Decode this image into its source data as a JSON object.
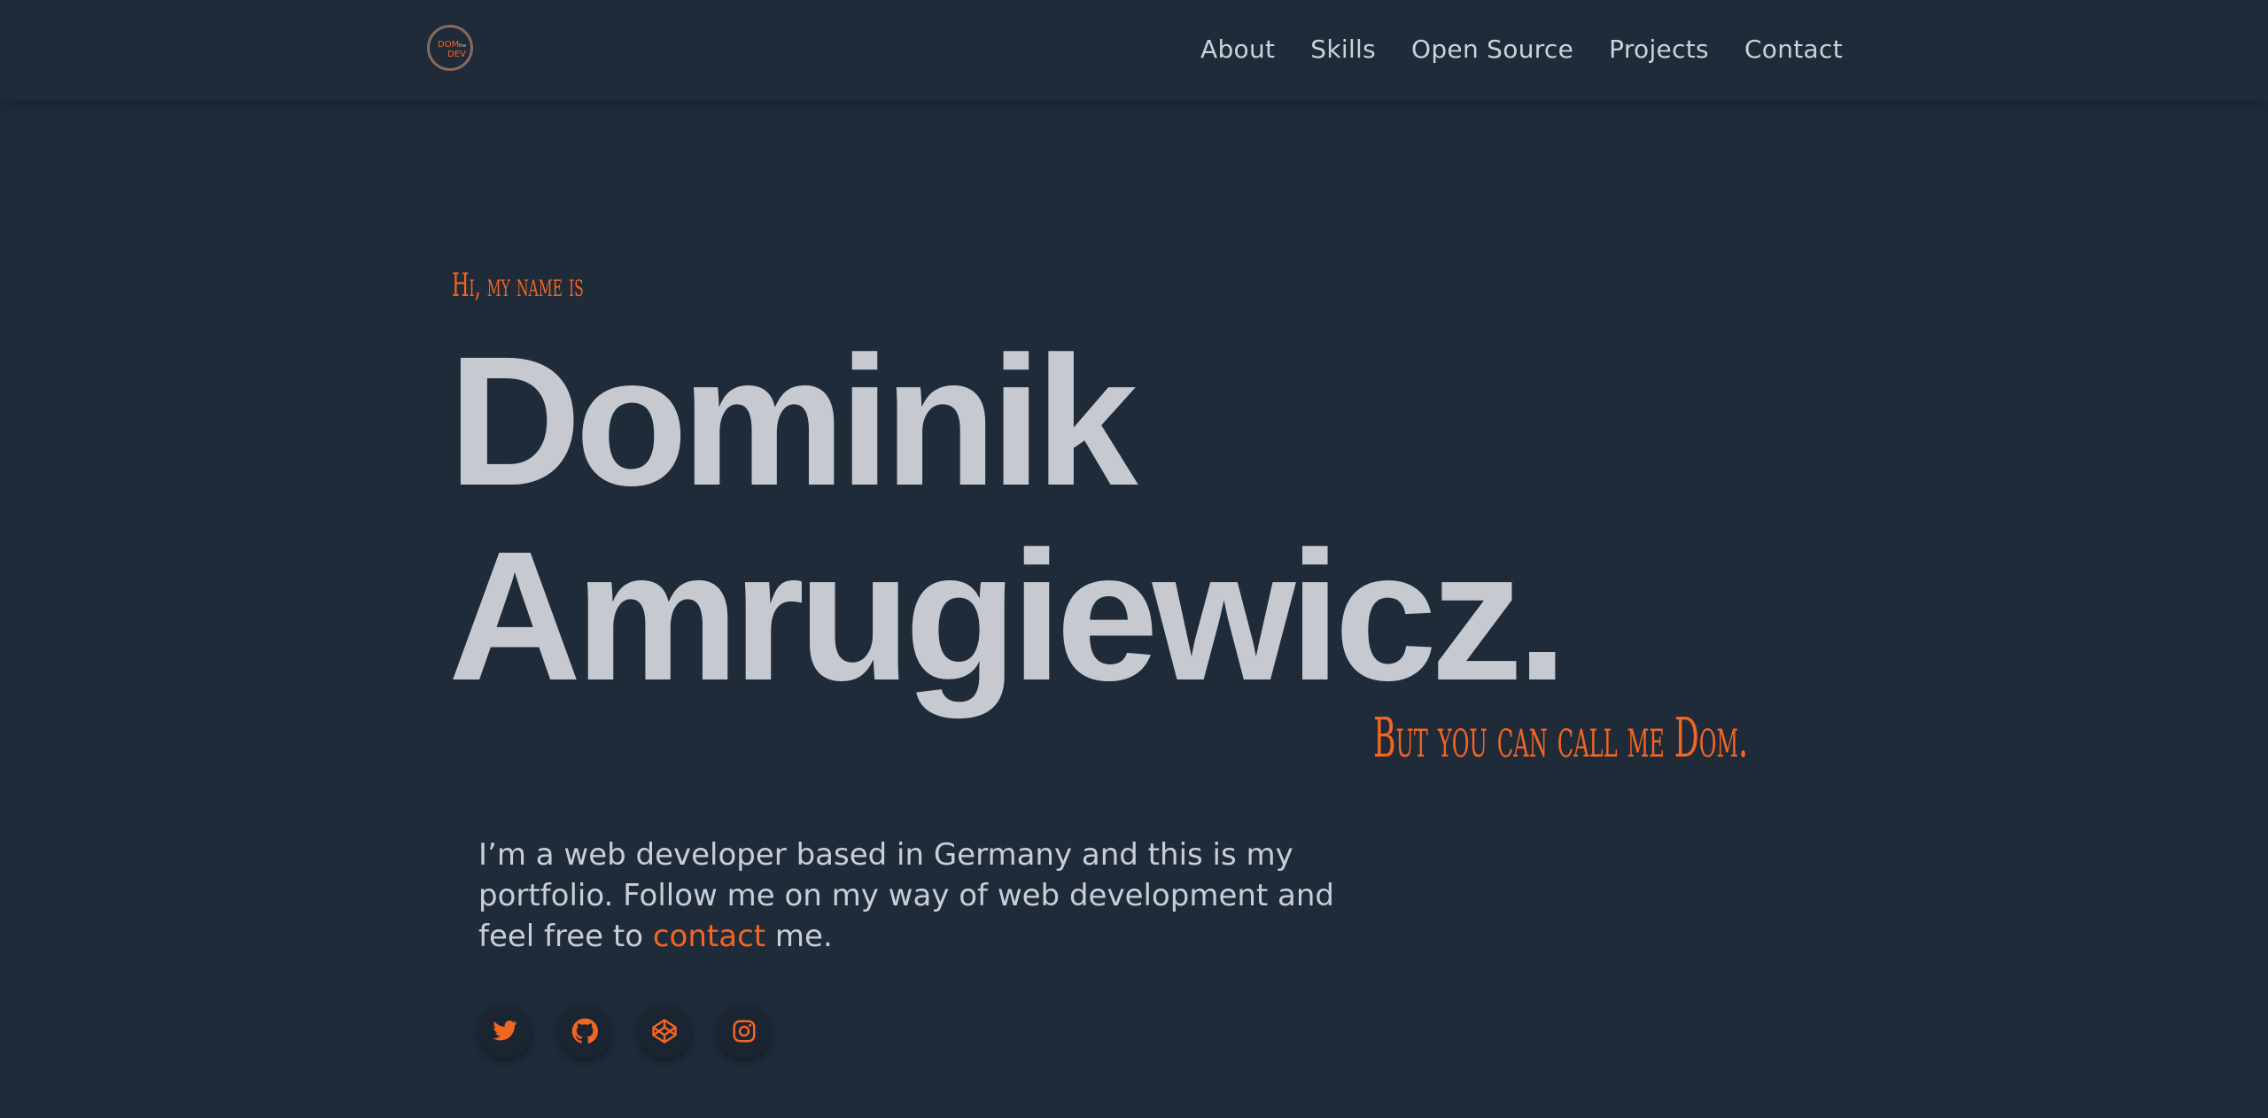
{
  "nav": {
    "logo_text_top": "DOM",
    "logo_text_small": "the",
    "logo_text_bottom": "DEV",
    "links": [
      "About",
      "Skills",
      "Open Source",
      "Projects",
      "Contact"
    ]
  },
  "hero": {
    "greeting": "Hi, my name is",
    "name_first": "Dominik",
    "name_last": "Amrugiewicz.",
    "nickname": "But you can call me Dom.",
    "intro_before": "I’m a web developer based in Germany and this is my portfolio. Follow me on my way of web development and feel free to ",
    "intro_link": "contact",
    "intro_after": " me."
  },
  "socials": [
    "twitter-icon",
    "github-icon",
    "codepen-icon",
    "instagram-icon"
  ],
  "colors": {
    "background": "#1f2b39",
    "accent": "#f26522",
    "name_text": "#c6cad0",
    "body_text": "#c9ced6"
  }
}
